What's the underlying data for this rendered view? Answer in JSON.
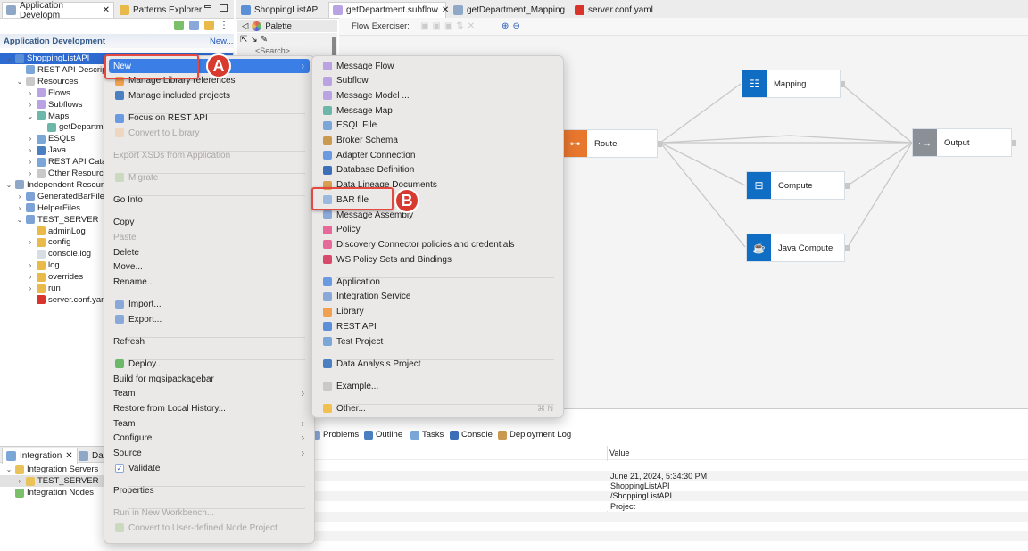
{
  "left_tabs": [
    {
      "label": "Application Developm",
      "icon": "app-dev-icon",
      "close": "✕"
    },
    {
      "label": "Patterns Explorer",
      "icon": "patterns-icon"
    }
  ],
  "left_header": {
    "title": "Application Development",
    "new_link": "New..."
  },
  "tree": [
    {
      "label": "ShoppingListAPI",
      "level": 0,
      "arrow": "v",
      "selected": true,
      "color": "#5b8fd8"
    },
    {
      "label": "REST API Descript",
      "level": 1,
      "arrow": "",
      "color": "#7aa6d8"
    },
    {
      "label": "Resources",
      "level": 1,
      "arrow": "v",
      "color": "#c9c9c9"
    },
    {
      "label": "Flows",
      "level": 2,
      "arrow": ">",
      "color": "#b9a3e3"
    },
    {
      "label": "Subflows",
      "level": 2,
      "arrow": ">",
      "color": "#b9a3e3"
    },
    {
      "label": "Maps",
      "level": 2,
      "arrow": "v",
      "color": "#6cb7a9"
    },
    {
      "label": "getDepartme",
      "level": 3,
      "arrow": "",
      "color": "#6cb7a9"
    },
    {
      "label": "ESQLs",
      "level": 2,
      "arrow": ">",
      "color": "#7aa6d8"
    },
    {
      "label": "Java",
      "level": 2,
      "arrow": ">",
      "color": "#4a7fc1"
    },
    {
      "label": "REST API Catalo",
      "level": 2,
      "arrow": ">",
      "color": "#7aa6d8"
    },
    {
      "label": "Other Resource",
      "level": 2,
      "arrow": ">",
      "color": "#c9c9c9"
    },
    {
      "label": "Independent Resourc",
      "level": 0,
      "arrow": "v",
      "color": "#8fa8c8"
    },
    {
      "label": "GeneratedBarFiles",
      "level": 1,
      "arrow": ">",
      "color": "#7da2d6"
    },
    {
      "label": "HelperFiles",
      "level": 1,
      "arrow": ">",
      "color": "#7da2d6"
    },
    {
      "label": "TEST_SERVER",
      "level": 1,
      "arrow": "v",
      "color": "#7da2d6"
    },
    {
      "label": "adminLog",
      "level": 2,
      "arrow": "",
      "color": "#e9b949"
    },
    {
      "label": "config",
      "level": 2,
      "arrow": ">",
      "color": "#e9b949"
    },
    {
      "label": "console.log",
      "level": 2,
      "arrow": "",
      "color": "#d8dde5"
    },
    {
      "label": "log",
      "level": 2,
      "arrow": ">",
      "color": "#e9b949"
    },
    {
      "label": "overrides",
      "level": 2,
      "arrow": ">",
      "color": "#e9b949"
    },
    {
      "label": "run",
      "level": 2,
      "arrow": ">",
      "color": "#e9b949"
    },
    {
      "label": "server.conf.yam",
      "level": 2,
      "arrow": "",
      "color": "#d9342b"
    }
  ],
  "bottom_left_tabs": [
    {
      "label": "Integration",
      "close": "✕"
    },
    {
      "label": "Data"
    }
  ],
  "integration_tree": [
    {
      "label": "Integration Servers",
      "level": 0,
      "arrow": "v",
      "color": "#e9c35a"
    },
    {
      "label": "TEST_SERVER",
      "level": 1,
      "arrow": ">",
      "selected": true,
      "color": "#e9c35a"
    },
    {
      "label": "Integration Nodes",
      "level": 0,
      "arrow": "",
      "color": "#7bbf6a"
    }
  ],
  "editor_tabs": [
    {
      "label": "ShoppingListAPI",
      "color": "#5b8fd8"
    },
    {
      "label": "getDepartment.subflow",
      "color": "#b9a3e3",
      "active": true,
      "close": "✕"
    },
    {
      "label": "getDepartment_Mapping",
      "color": "#8fa8c8"
    },
    {
      "label": "server.conf.yaml",
      "color": "#d9342b"
    }
  ],
  "palette": {
    "label": "Palette",
    "search": "<Search>"
  },
  "toolbar": {
    "flow_exerciser": "Flow Exerciser:"
  },
  "flow_nodes": [
    {
      "label": "Route",
      "color": "#e8772e",
      "icon": "route-icon",
      "glyph": "⊶"
    },
    {
      "label": "Mapping",
      "color": "#0f6dc4",
      "icon": "mapping-icon",
      "glyph": "☷"
    },
    {
      "label": "Compute",
      "color": "#0f6dc4",
      "icon": "compute-chip-icon",
      "glyph": "⊞"
    },
    {
      "label": "Java Compute",
      "color": "#0f6dc4",
      "icon": "java-cup-icon",
      "glyph": "☕"
    },
    {
      "label": "Output",
      "color": "#8b9096",
      "icon": "output-arrow-icon",
      "glyph": "·→"
    }
  ],
  "context_menu": [
    {
      "label": "New",
      "sub": true,
      "highlight": true,
      "noicon": true
    },
    {
      "label": "Manage Library references",
      "color": "#f0a050"
    },
    {
      "label": "Manage included projects",
      "color": "#4a7fc1"
    },
    {
      "sep": true
    },
    {
      "label": "Focus on REST API",
      "color": "#6a9be0"
    },
    {
      "label": "Convert to Library",
      "disabled": true,
      "color": "#f3c39a"
    },
    {
      "sep": true
    },
    {
      "label": "Export XSDs from Application",
      "disabled": true,
      "noicon": true
    },
    {
      "sep": true
    },
    {
      "label": "Migrate",
      "disabled": true,
      "color": "#a9c99a"
    },
    {
      "sep": true
    },
    {
      "label": "Go Into",
      "noicon": true
    },
    {
      "sep": true
    },
    {
      "label": "Copy",
      "noicon": true
    },
    {
      "label": "Paste",
      "disabled": true,
      "noicon": true
    },
    {
      "label": "Delete",
      "noicon": true
    },
    {
      "label": "Move...",
      "noicon": true
    },
    {
      "label": "Rename...",
      "noicon": true
    },
    {
      "sep": true
    },
    {
      "label": "Import...",
      "color": "#8aa8d8"
    },
    {
      "label": "Export...",
      "color": "#8aa8d8"
    },
    {
      "sep": true
    },
    {
      "label": "Refresh",
      "noicon": true
    },
    {
      "sep": true
    },
    {
      "label": "Deploy...",
      "color": "#6cb86a"
    },
    {
      "label": "Build for mqsipackagebar",
      "noicon": true
    },
    {
      "label": "Team",
      "sub": true,
      "noicon": true
    },
    {
      "label": "Restore from Local History...",
      "noicon": true
    },
    {
      "label": "Team",
      "sub": true,
      "noicon": true
    },
    {
      "label": "Configure",
      "sub": true,
      "noicon": true
    },
    {
      "label": "Source",
      "sub": true,
      "noicon": true
    },
    {
      "label": "Validate",
      "checkbox": true,
      "checked": true
    },
    {
      "sep": true
    },
    {
      "label": "Properties",
      "noicon": true
    },
    {
      "sep": true
    },
    {
      "label": "Run in New Workbench...",
      "disabled": true,
      "noicon": true
    },
    {
      "label": "Convert to User-defined Node Project",
      "disabled": true,
      "color": "#a9c99a"
    }
  ],
  "submenu": [
    {
      "label": "Message Flow",
      "color": "#b9a3e3"
    },
    {
      "label": "Subflow",
      "color": "#b9a3e3"
    },
    {
      "label": "Message Model ...",
      "color": "#b9a3e3"
    },
    {
      "label": "Message Map",
      "color": "#6cb7a9"
    },
    {
      "label": "ESQL File",
      "color": "#7aa6d8"
    },
    {
      "label": "Broker Schema",
      "color": "#c99a50"
    },
    {
      "label": "Adapter Connection",
      "color": "#6a9be0"
    },
    {
      "label": "Database Definition",
      "color": "#3d6fb8"
    },
    {
      "label": "Data Lineage Documents",
      "color": "#d8a050"
    },
    {
      "label": "BAR file",
      "color": "#9ab8e0"
    },
    {
      "label": "Message Assembly",
      "color": "#8aa8d8"
    },
    {
      "label": "Policy",
      "color": "#e56a9a"
    },
    {
      "label": "Discovery Connector policies and credentials",
      "color": "#e56a9a"
    },
    {
      "label": "WS Policy Sets and Bindings",
      "color": "#d84a6a"
    },
    {
      "sep": true
    },
    {
      "label": "Application",
      "color": "#6a9be0"
    },
    {
      "label": "Integration Service",
      "color": "#8aa8d8"
    },
    {
      "label": "Library",
      "color": "#f0a050"
    },
    {
      "label": "REST API",
      "color": "#5b8fd8"
    },
    {
      "label": "Test Project",
      "color": "#7aa6d8"
    },
    {
      "sep": true
    },
    {
      "label": "Data Analysis Project",
      "color": "#4a7fc1"
    },
    {
      "sep": true
    },
    {
      "label": "Example...",
      "color": "#c9c9c9"
    },
    {
      "sep": true
    },
    {
      "label": "Other...",
      "color": "#f0c050",
      "shortcut": "⌘ N"
    }
  ],
  "annotations": {
    "a": "A",
    "b": "B",
    "color": "#d83a2f"
  },
  "bottom_tabs": [
    {
      "label": "Problems",
      "color": "#8aa8d8"
    },
    {
      "label": "Outline",
      "color": "#4a7fc1"
    },
    {
      "label": "Tasks",
      "color": "#7aa6d8"
    },
    {
      "label": "Console",
      "color": "#3d6fb8"
    },
    {
      "label": "Deployment Log",
      "color": "#c99a50"
    }
  ],
  "properties": {
    "value_header": "Value",
    "values": [
      "",
      "June 21, 2024, 5:34:30 PM",
      "ShoppingListAPI",
      "/ShoppingListAPI",
      "Project",
      "",
      "",
      "",
      ""
    ]
  }
}
